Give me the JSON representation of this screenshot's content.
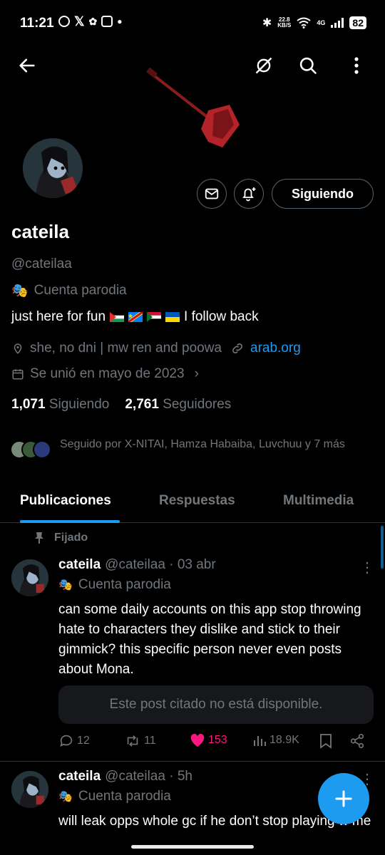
{
  "status_bar": {
    "time": "11:21",
    "net_speed": "22.8\nKB/S",
    "network": "4G",
    "battery": "82"
  },
  "profile": {
    "name": "cateila",
    "handle": "@cateilaa",
    "parody_label": "Cuenta parodia",
    "bio_start": "just here for fun",
    "bio_end": "I follow back",
    "location": "she, no dni | mw ren and poowa",
    "website": "arab.org",
    "joined": "Se unió en mayo de 2023",
    "follow_button": "Siguiendo",
    "following_count": "1,071",
    "following_label": "Siguiendo",
    "followers_count": "2,761",
    "followers_label": "Seguidores",
    "followed_by": "Seguido por X-NITAI, Hamza Habaiba, Luvchuu y 7 más"
  },
  "tabs": [
    {
      "label": "Publicaciones"
    },
    {
      "label": "Respuestas"
    },
    {
      "label": "Multimedia"
    }
  ],
  "pinned_label": "Fijado",
  "posts": [
    {
      "name": "cateila",
      "handle_time": "@cateilaa · 03 abr",
      "parody_label": "Cuenta parodia",
      "text": "can some daily accounts on this app stop throwing hate to characters they dislike and stick to their gimmick? this specific person never even posts about Mona.",
      "quote": "Este post citado no está disponible.",
      "replies": "12",
      "reposts": "11",
      "likes": "153",
      "views": "18.9K"
    },
    {
      "name": "cateila",
      "handle_time": "@cateilaa · 5h",
      "parody_label": "Cuenta parodia",
      "text": "will leak opps whole gc if he don’t stop playing w me"
    }
  ],
  "colors": {
    "accent": "#1d9bf0",
    "like": "#f91880",
    "muted": "#71767b",
    "background": "#000000"
  }
}
